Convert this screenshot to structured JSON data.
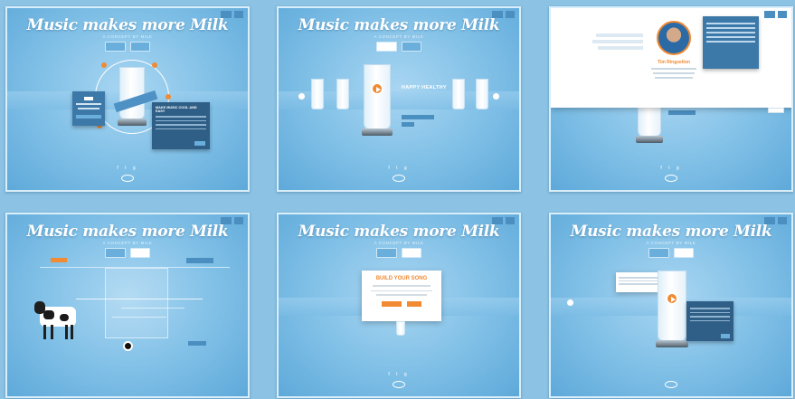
{
  "panels": [
    {
      "title": "Music makes more Milk",
      "subtitle": "A CONCEPT BY MILK",
      "tabs": [
        "",
        "",
        ""
      ],
      "top": [
        "",
        ""
      ]
    },
    {
      "title": "Music makes more Milk",
      "subtitle": "A CONCEPT BY MILK",
      "tabs": [
        "",
        ""
      ],
      "top": [
        "",
        ""
      ]
    },
    {
      "person": "Tim Ringselton",
      "top": [
        "",
        ""
      ]
    },
    {
      "title": "Music makes more Milk",
      "subtitle": "A CONCEPT BY MILK",
      "tabs": [
        "",
        ""
      ],
      "top": [
        "",
        ""
      ]
    },
    {
      "title": "Music makes more Milk",
      "subtitle": "A CONCEPT BY MILK",
      "tabs": [
        "",
        ""
      ],
      "top": [
        "",
        ""
      ],
      "card_title": "BUILD YOUR SONG"
    },
    {
      "title": "Music makes more Milk",
      "subtitle": "A CONCEPT BY MILK",
      "tabs": [
        "",
        ""
      ],
      "top": [
        "",
        ""
      ]
    }
  ],
  "panel1": {
    "card_left": "",
    "card_right": "MAKE MUSIC COOL AND EASY"
  },
  "panel2": {
    "label": "HAPPY HEALTHY"
  },
  "footer": {
    "social": "f t g"
  },
  "colors": {
    "accent": "#f08a33",
    "panel_blue": "#7fbfe6",
    "dark_card": "#2f5f86"
  }
}
